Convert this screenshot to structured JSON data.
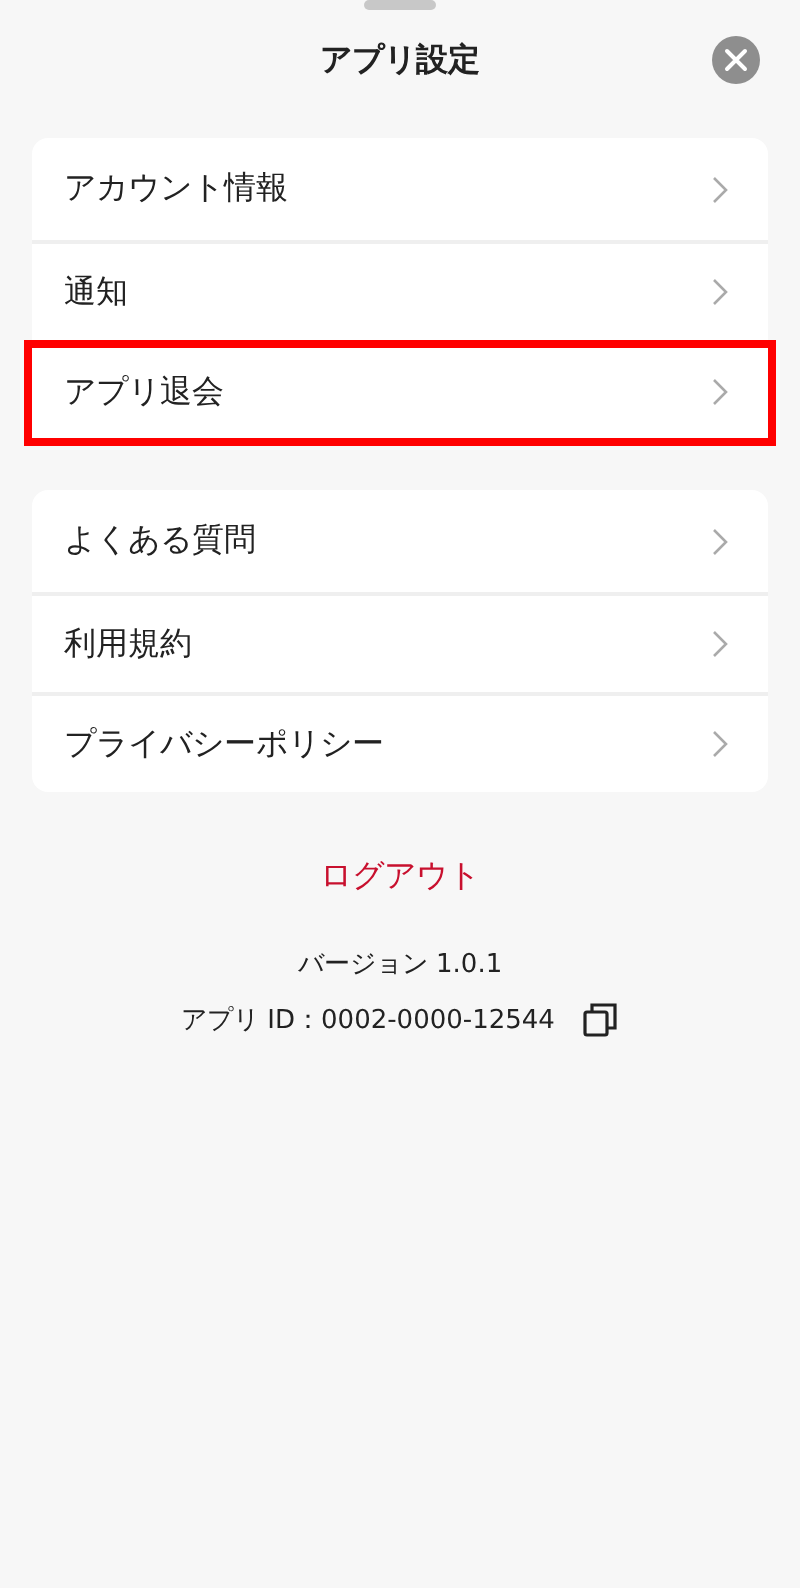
{
  "header": {
    "title": "アプリ設定"
  },
  "groups": [
    {
      "items": [
        {
          "label": "アカウント情報",
          "highlighted": false
        },
        {
          "label": "通知",
          "highlighted": false
        },
        {
          "label": "アプリ退会",
          "highlighted": true
        }
      ]
    },
    {
      "items": [
        {
          "label": "よくある質問",
          "highlighted": false
        },
        {
          "label": "利用規約",
          "highlighted": false
        },
        {
          "label": "プライバシーポリシー",
          "highlighted": false
        }
      ]
    }
  ],
  "logout": "ログアウト",
  "version": "バージョン 1.0.1",
  "app_id": "アプリ ID：0002-0000-12544"
}
